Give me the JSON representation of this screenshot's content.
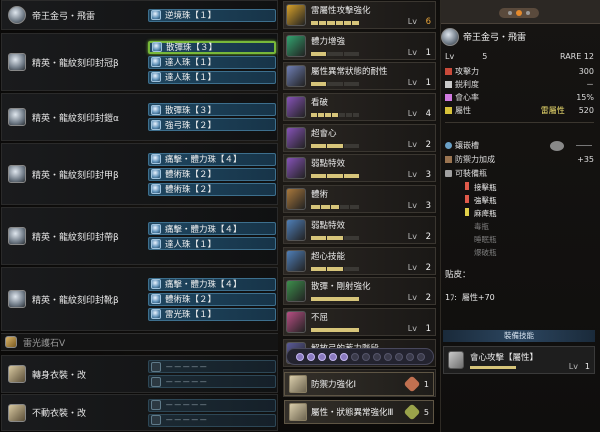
{
  "weapon_title": "帝王金弓・飛雷",
  "equipment": [
    {
      "name": "帝王金弓・飛雷",
      "decos": [
        "逆境珠【１】"
      ]
    },
    {
      "name": "精英・龍紋刻印封冠β",
      "decos": [
        "散彈珠【３】",
        "達人珠【１】",
        "達人珠【１】"
      ]
    },
    {
      "name": "精英・龍紋刻印封鎧α",
      "decos": [
        "散彈珠【３】",
        "強弓珠【２】"
      ]
    },
    {
      "name": "精英・龍紋刻印封甲β",
      "decos": [
        "痛擊・體力珠【４】",
        "體術珠【２】",
        "體術珠【２】"
      ]
    },
    {
      "name": "精英・龍紋刻印封帶β",
      "decos": [
        "痛擊・體力珠【４】",
        "達人珠【１】"
      ]
    },
    {
      "name": "精英・龍紋刻印封靴β",
      "decos": [
        "痛擊・體力珠【４】",
        "體術珠【２】",
        "雷光珠【１】"
      ]
    }
  ],
  "charm": {
    "name": "雷光護石Ⅴ"
  },
  "mantles": [
    {
      "name": "轉身衣裝・改",
      "slots": [
        "－－－－－",
        "－－－－－"
      ]
    },
    {
      "name": "不動衣裝・改",
      "slots": [
        "－－－－－",
        "－－－－－"
      ]
    }
  ],
  "skills": [
    {
      "name": "雷屬性攻擊強化",
      "lv_label": "Lv",
      "level": "6",
      "filled": 6,
      "max": 6,
      "color": "#d7a12a"
    },
    {
      "name": "體力增強",
      "lv_label": "Lv",
      "level": "1",
      "filled": 1,
      "max": 3,
      "color": "#33a36f"
    },
    {
      "name": "屬性異常狀態的耐性",
      "lv_label": "Lv",
      "level": "1",
      "filled": 1,
      "max": 3,
      "color": "#6f7fb4"
    },
    {
      "name": "看破",
      "lv_label": "Lv",
      "level": "4",
      "filled": 4,
      "max": 7,
      "color": "#8653b7"
    },
    {
      "name": "超會心",
      "lv_label": "Lv",
      "level": "2",
      "filled": 2,
      "max": 3,
      "color": "#8653b7"
    },
    {
      "name": "弱點特效",
      "lv_label": "Lv",
      "level": "3",
      "filled": 3,
      "max": 3,
      "color": "#8653b7"
    },
    {
      "name": "體術",
      "lv_label": "Lv",
      "level": "3",
      "filled": 3,
      "max": 5,
      "color": "#a8783c"
    },
    {
      "name": "弱點特效",
      "lv_label": "Lv",
      "level": "2",
      "filled": 2,
      "max": 3,
      "color": "#4f7fb8"
    },
    {
      "name": "超心技能",
      "lv_label": "Lv",
      "level": "2",
      "filled": 2,
      "max": 3,
      "color": "#4f7fb8"
    },
    {
      "name": "散彈・剛射強化",
      "lv_label": "Lv",
      "level": "2",
      "filled": 1,
      "max": 1,
      "color": "#3d8f4c"
    },
    {
      "name": "不屈",
      "lv_label": "Lv",
      "level": "1",
      "filled": 1,
      "max": 1,
      "color": "#b84f84"
    },
    {
      "name": "解放弓的蓄力階段",
      "lv_label": "Lv",
      "level": "1",
      "filled": 1,
      "max": 1,
      "color": "#5a5a99"
    },
    {
      "name": "會心攻擊【屬性】",
      "lv_label": "Lv",
      "level": "1",
      "filled": 1,
      "max": 1,
      "color": "#999999"
    }
  ],
  "set_bonuses": [
    {
      "name": "防禦力強化Ⅰ",
      "count": "1",
      "color": "#c07050"
    },
    {
      "name": "屬性・狀態異常強化Ⅲ",
      "count": "5",
      "color": "#9aa34a"
    }
  ],
  "right": {
    "title": "帝王金弓・飛雷",
    "lv_label": "Lv",
    "lv": "5",
    "rare": "RARE 12",
    "stats": [
      {
        "label": "攻擊力",
        "value": "300",
        "color": "#c94a3a"
      },
      {
        "label": "鋭利度",
        "value": "－",
        "color": "#c9c9c9"
      },
      {
        "label": "會心率",
        "value": "15%",
        "color": "#d17be0"
      },
      {
        "label": "屬性",
        "element": "雷屬性",
        "value": "520",
        "color": "#d8c23a"
      }
    ],
    "slot_label": "鑲嵌槽",
    "defense_label": "防禦力加成",
    "defense_value": "+35",
    "coating_label": "可裝備瓶",
    "coatings": [
      {
        "name": "接擊瓶",
        "color": "#e05a4a",
        "active": true
      },
      {
        "name": "強擊瓶",
        "color": "#e05a4a",
        "active": true
      },
      {
        "name": "麻痺瓶",
        "color": "#e0d04a",
        "active": true
      },
      {
        "name": "毒瓶",
        "color": "#888888",
        "active": false
      },
      {
        "name": "睡眠瓶",
        "color": "#888888",
        "active": false
      },
      {
        "name": "爆破瓶",
        "color": "#888888",
        "active": false
      }
    ],
    "kinship_label": "贴皮：",
    "kinship_value": "1ﾌ:  屬性+70",
    "equip_skill_label": "裝備技能",
    "equip_skill": {
      "name": "會心攻擊【屬性】",
      "lv_label": "Lv",
      "level": "1"
    }
  }
}
